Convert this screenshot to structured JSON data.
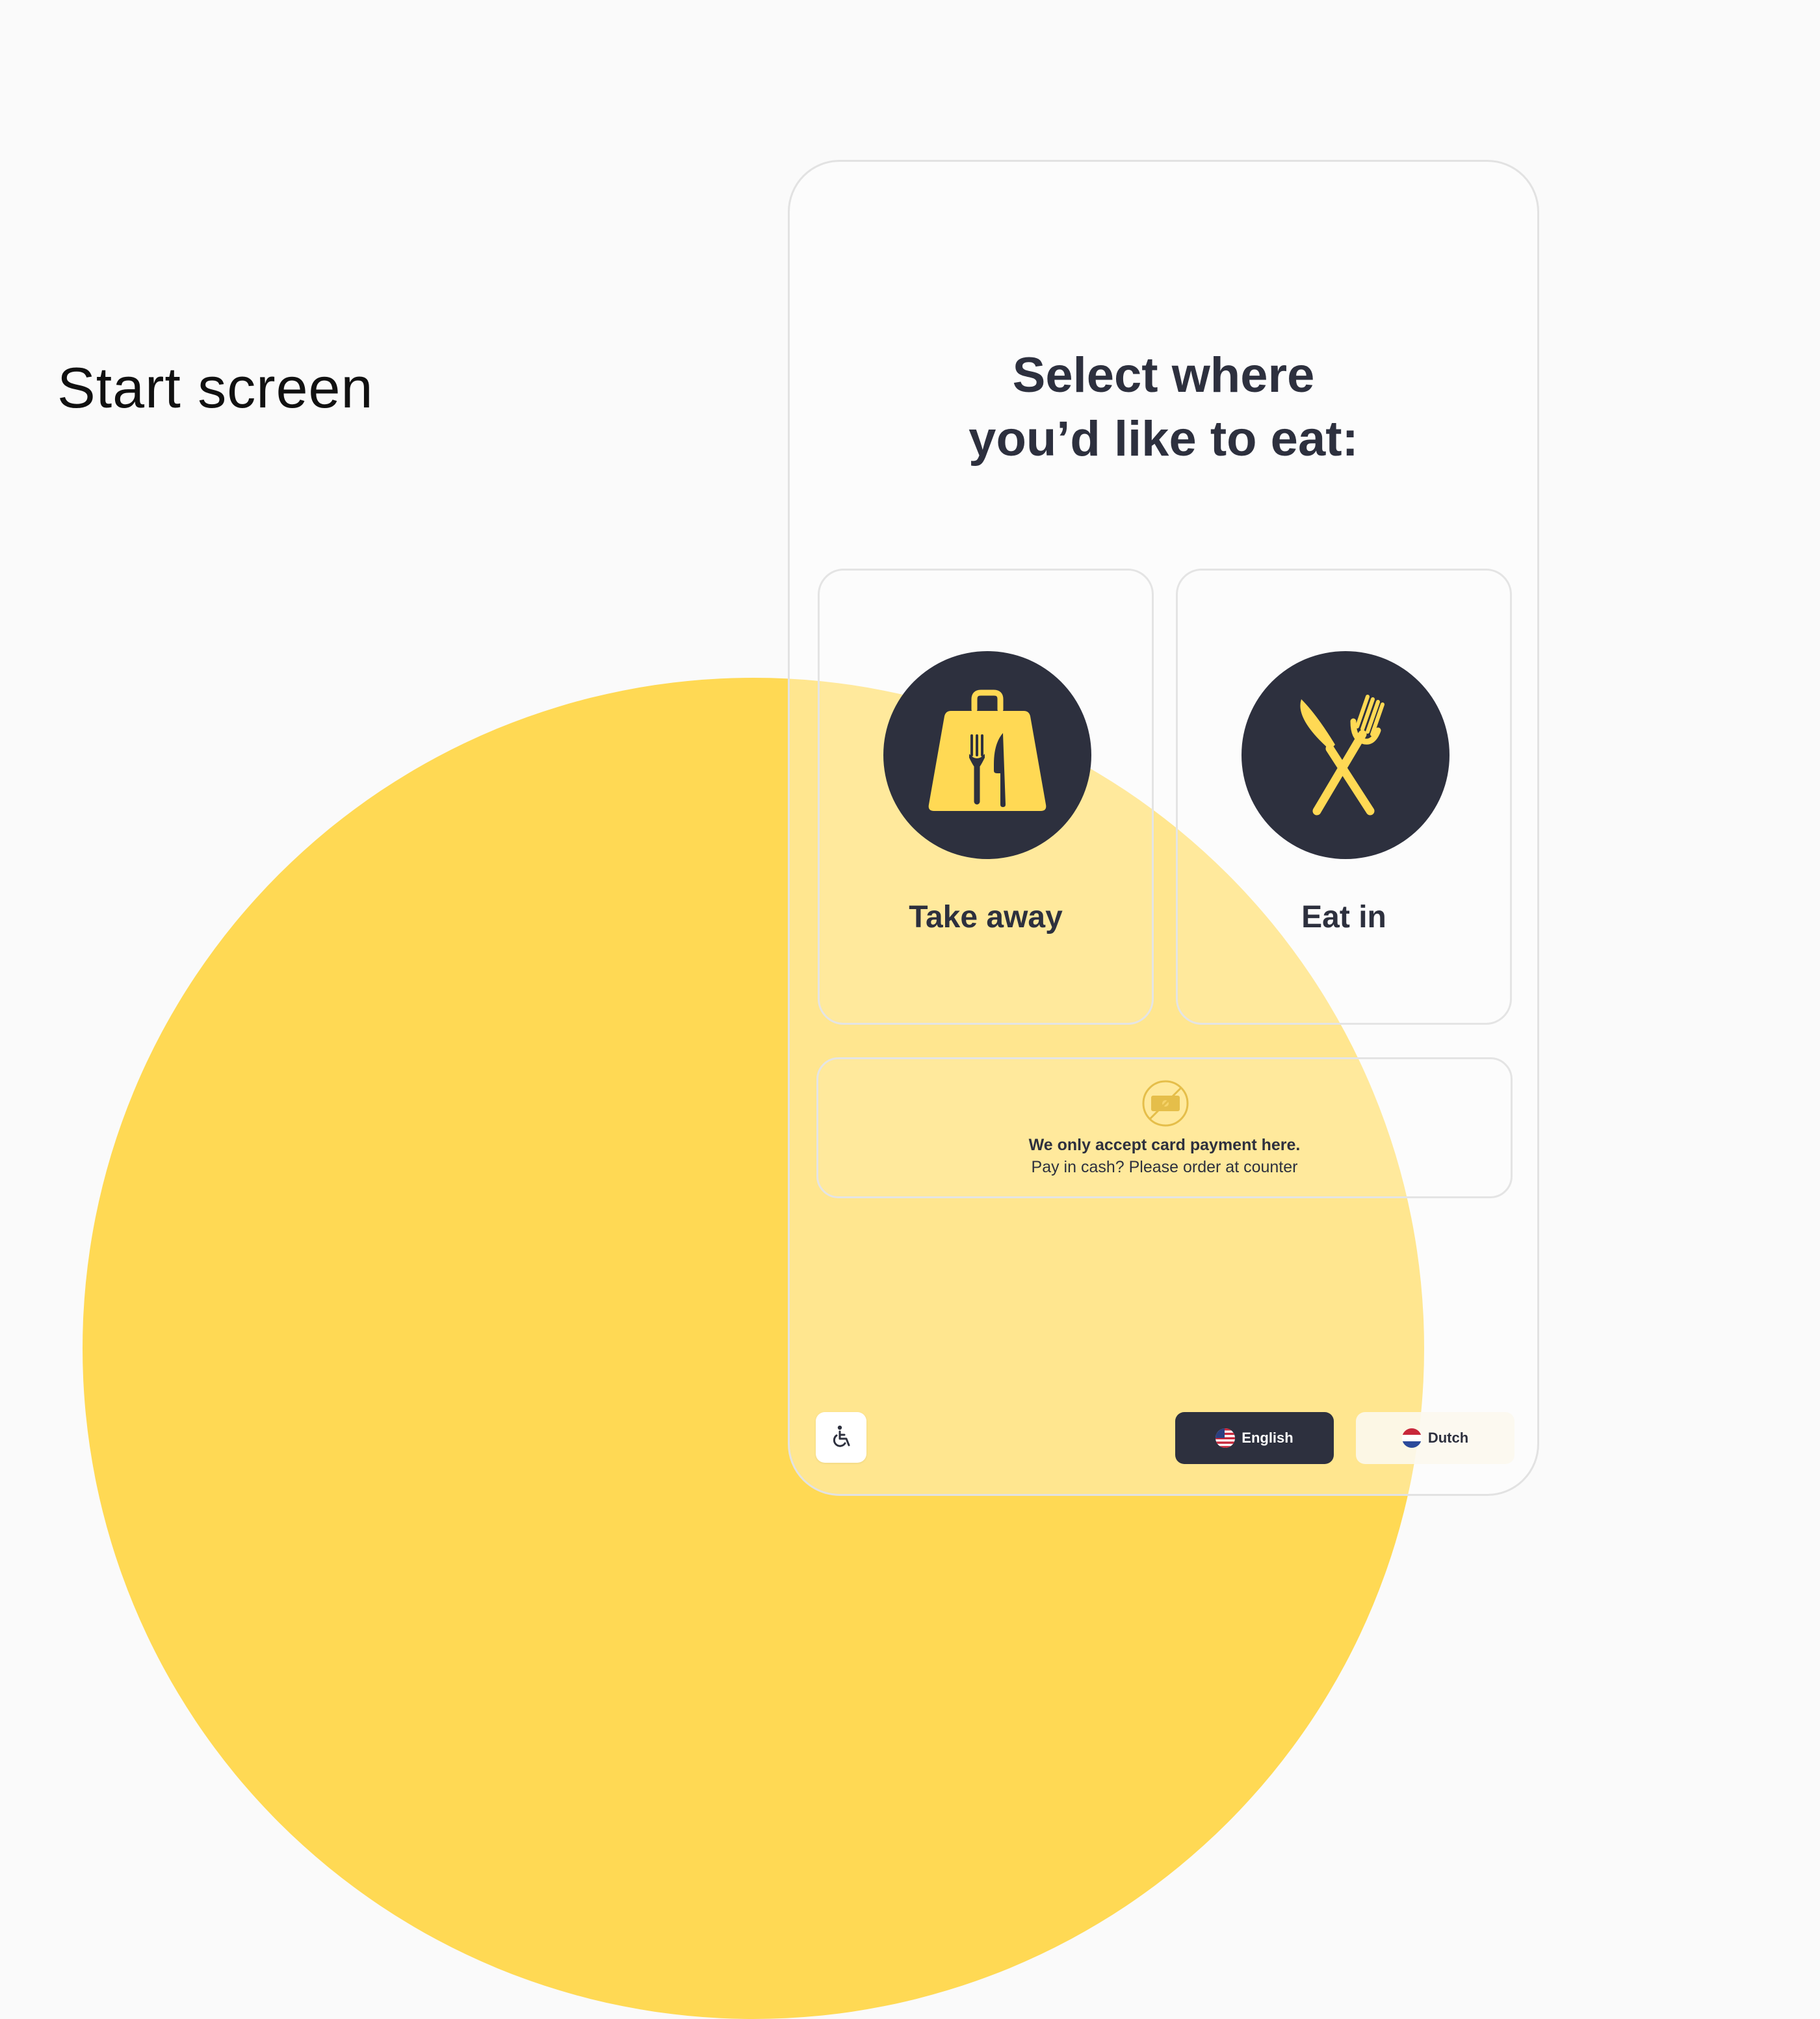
{
  "page": {
    "section_title": "Start screen"
  },
  "kiosk": {
    "heading_line1": "Select where",
    "heading_line2": "you’d like to eat:",
    "options": [
      {
        "label": "Take away",
        "icon": "shopping-bag-cutlery-icon"
      },
      {
        "label": "Eat in",
        "icon": "knife-fork-crossed-icon"
      }
    ],
    "notice": {
      "icon": "no-cash-icon",
      "bold": "We only accept card payment here.",
      "text": "Pay in cash? Please order at counter"
    },
    "footer": {
      "accessibility_icon": "wheelchair-icon",
      "languages": [
        {
          "label": "English",
          "flag": "us-flag-icon",
          "selected": true
        },
        {
          "label": "Dutch",
          "flag": "netherlands-flag-icon",
          "selected": false
        }
      ]
    }
  },
  "colors": {
    "accent_yellow": "#ffd954",
    "dark_navy": "#2d303e",
    "background": "#fafafa"
  }
}
